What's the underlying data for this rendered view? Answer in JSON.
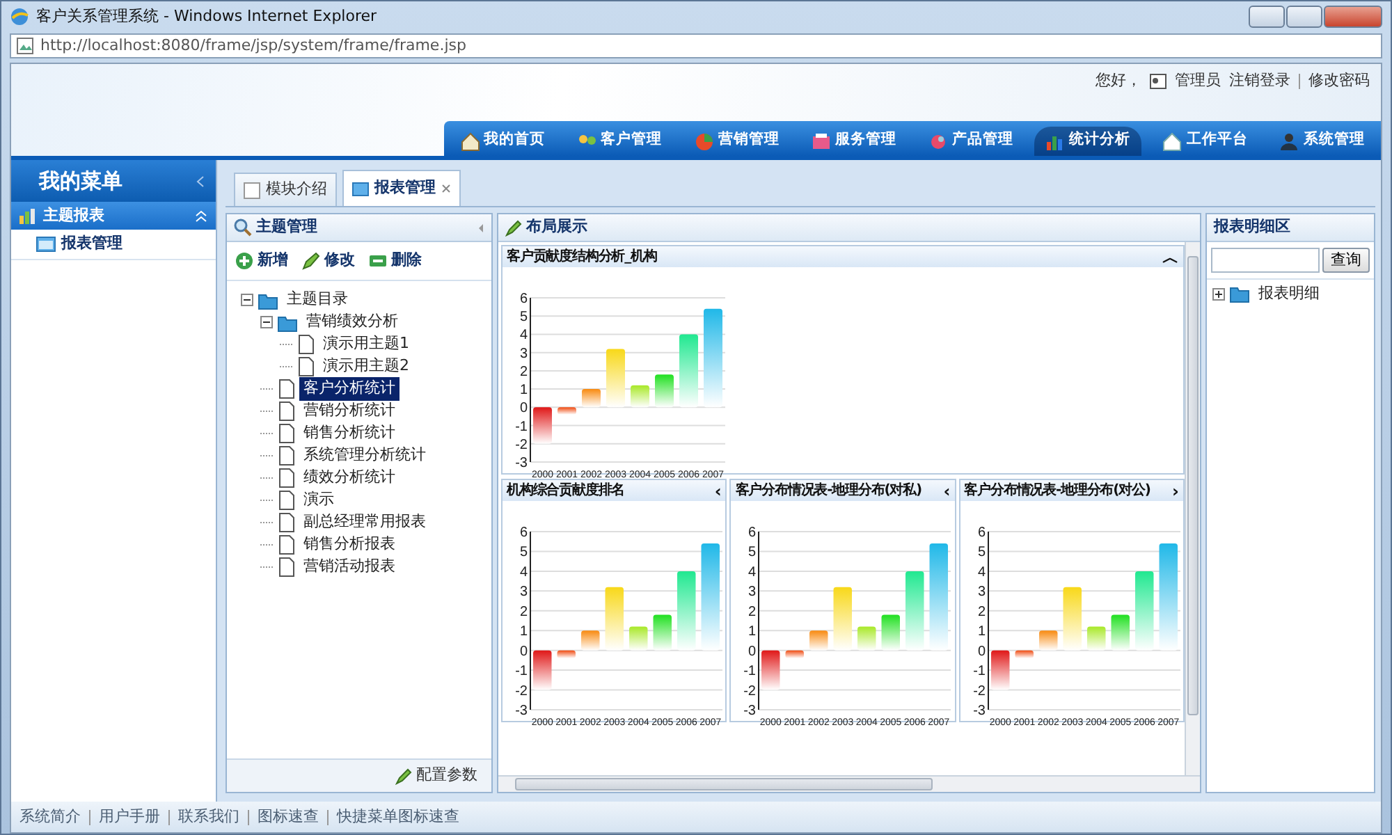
{
  "window": {
    "title": "客户关系管理系统 - Windows Internet Explorer",
    "address": "http://localhost:8080/frame/jsp/system/frame/frame.jsp"
  },
  "user_bar": {
    "greeting": "您好，",
    "user": "管理员",
    "links": [
      "注销登录",
      "修改密码"
    ]
  },
  "nav": [
    {
      "label": "我的首页",
      "selected": false
    },
    {
      "label": "客户管理",
      "selected": false
    },
    {
      "label": "营销管理",
      "selected": false
    },
    {
      "label": "服务管理",
      "selected": false
    },
    {
      "label": "产品管理",
      "selected": false
    },
    {
      "label": "统计分析",
      "selected": true
    },
    {
      "label": "工作平台",
      "selected": false
    },
    {
      "label": "系统管理",
      "selected": false
    }
  ],
  "sidebar": {
    "title": "我的菜单",
    "group": {
      "label": "主题报表",
      "expanded": true
    },
    "items": [
      {
        "label": "报表管理",
        "selected": false
      }
    ]
  },
  "tabs": [
    {
      "label": "模块介绍",
      "selected": false,
      "closable": false
    },
    {
      "label": "报表管理",
      "selected": true,
      "closable": true
    }
  ],
  "tree_panel": {
    "title": "主题管理",
    "toolbar": [
      {
        "kind": "add",
        "label": "新增"
      },
      {
        "kind": "edit",
        "label": "修改"
      },
      {
        "kind": "delete",
        "label": "删除"
      }
    ],
    "tree": [
      {
        "kind": "folder",
        "label": "主题目录",
        "expanded": true,
        "selected": false,
        "children": [
          {
            "kind": "folder",
            "label": "营销绩效分析",
            "expanded": true,
            "selected": false,
            "children": [
              {
                "kind": "file",
                "label": "演示用主题1",
                "selected": false
              },
              {
                "kind": "file",
                "label": "演示用主题2",
                "selected": false
              }
            ]
          },
          {
            "kind": "file",
            "label": "客户分析统计",
            "selected": true
          },
          {
            "kind": "file",
            "label": "营销分析统计",
            "selected": false
          },
          {
            "kind": "file",
            "label": "销售分析统计",
            "selected": false
          },
          {
            "kind": "file",
            "label": "系统管理分析统计",
            "selected": false
          },
          {
            "kind": "file",
            "label": "绩效分析统计",
            "selected": false
          },
          {
            "kind": "file",
            "label": "演示",
            "selected": false
          },
          {
            "kind": "file",
            "label": "副总经理常用报表",
            "selected": false
          },
          {
            "kind": "file",
            "label": "销售分析报表",
            "selected": false
          },
          {
            "kind": "file",
            "label": "营销活动报表",
            "selected": false
          }
        ]
      }
    ],
    "footer_button": "配置参数"
  },
  "layout_panel": {
    "title": "布局展示",
    "portlets": [
      {
        "title": "客户贡献度结构分析_机构",
        "toggle": "︿",
        "chart_data": {
          "type": "bar",
          "grid": true,
          "categories": [
            "2000",
            "2001",
            "2002",
            "2003",
            "2004",
            "2005",
            "2006",
            "2007"
          ],
          "ylim": [
            -3,
            6
          ],
          "yticks": [
            -3,
            -2,
            -1,
            0,
            1,
            2,
            3,
            4,
            5,
            6
          ],
          "values": [
            -2,
            -0.4,
            1,
            3.2,
            1.2,
            1.8,
            4,
            5.4
          ]
        }
      },
      {
        "title": "机构综合贡献度排名",
        "toggle": "‹",
        "chart_data": {
          "type": "bar",
          "grid": true,
          "categories": [
            "2000",
            "2001",
            "2002",
            "2003",
            "2004",
            "2005",
            "2006",
            "2007"
          ],
          "ylim": [
            -3,
            6
          ],
          "yticks": [
            -3,
            -2,
            -1,
            0,
            1,
            2,
            3,
            4,
            5,
            6
          ],
          "values": [
            -2,
            -0.4,
            1,
            3.2,
            1.2,
            1.8,
            4,
            5.4
          ]
        }
      },
      {
        "title": "客户分布情况表-地理分布(对私)",
        "toggle": "‹",
        "chart_data": {
          "type": "bar",
          "grid": true,
          "categories": [
            "2000",
            "2001",
            "2002",
            "2003",
            "2004",
            "2005",
            "2006",
            "2007"
          ],
          "ylim": [
            -3,
            6
          ],
          "yticks": [
            -3,
            -2,
            -1,
            0,
            1,
            2,
            3,
            4,
            5,
            6
          ],
          "values": [
            -2,
            -0.4,
            1,
            3.2,
            1.2,
            1.8,
            4,
            5.4
          ]
        }
      },
      {
        "title": "客户分布情况表-地理分布(对公)",
        "toggle": "›",
        "chart_data": {
          "type": "bar",
          "grid": true,
          "categories": [
            "2000",
            "2001",
            "2002",
            "2003",
            "2004",
            "2005",
            "2006",
            "2007"
          ],
          "ylim": [
            -3,
            6
          ],
          "yticks": [
            -3,
            -2,
            -1,
            0,
            1,
            2,
            3,
            4,
            5,
            6
          ],
          "values": [
            -2,
            -0.4,
            1,
            3.2,
            1.2,
            1.8,
            4,
            5.4
          ]
        }
      }
    ]
  },
  "detail_panel": {
    "title": "报表明细区",
    "search_button": "查询",
    "tree": [
      {
        "kind": "folder",
        "label": "报表明细",
        "expanded": false
      }
    ]
  },
  "footer_links": [
    "系统简介",
    "用户手册",
    "联系我们",
    "图标速查",
    "快捷菜单图标速查"
  ]
}
